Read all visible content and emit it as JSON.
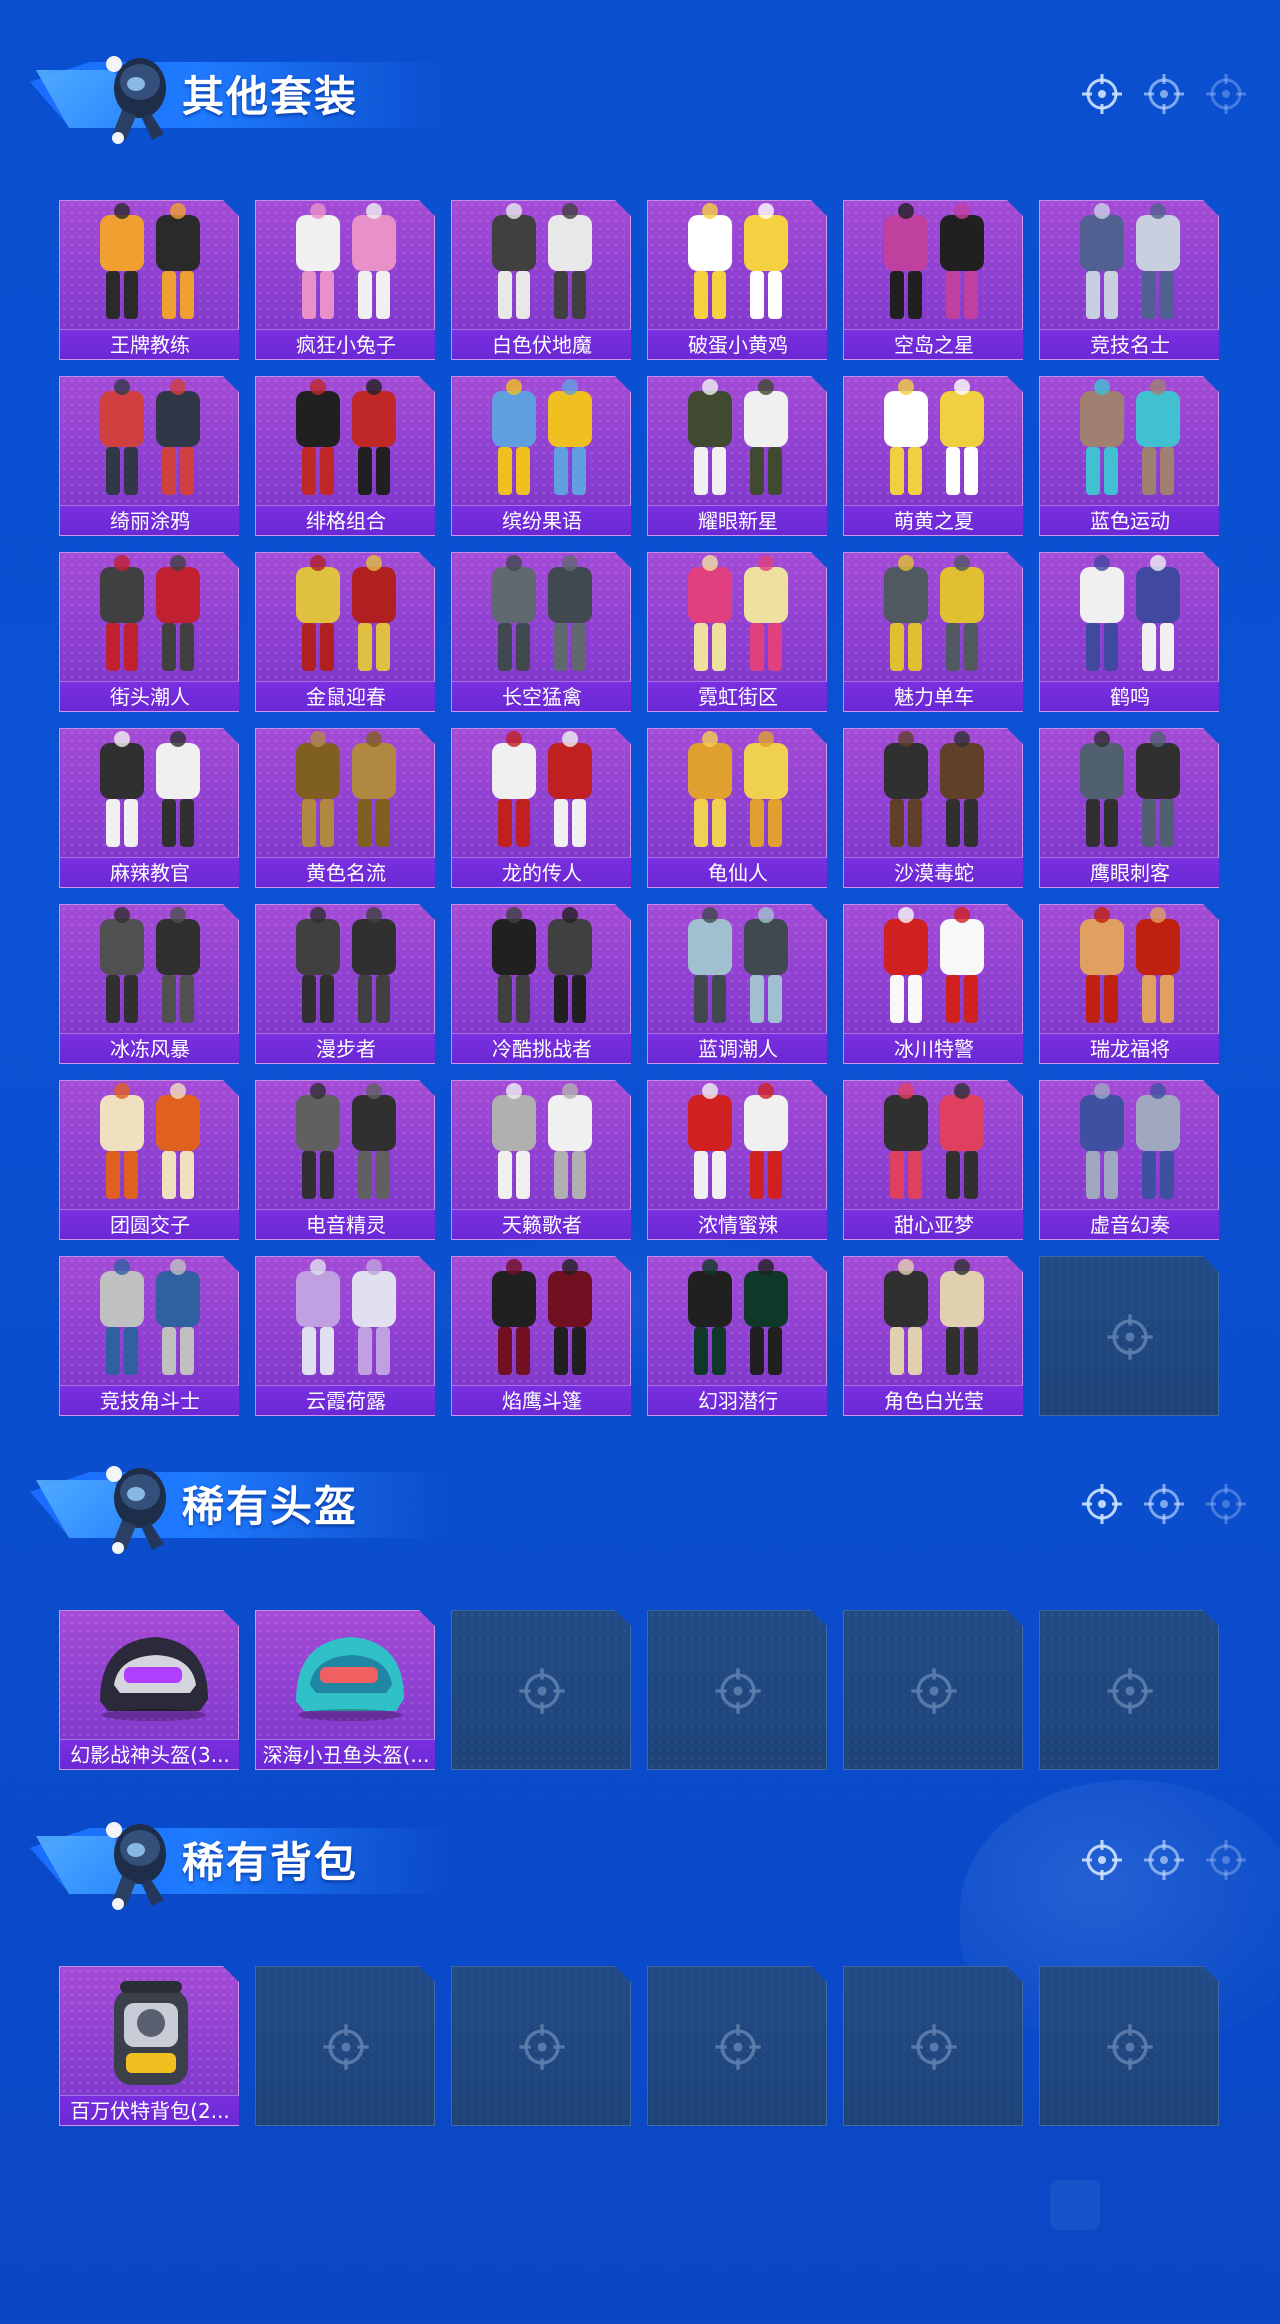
{
  "sections": [
    {
      "title": "其他套装",
      "items": [
        {
          "label": "王牌教练"
        },
        {
          "label": "疯狂小兔子"
        },
        {
          "label": "白色伏地魔"
        },
        {
          "label": "破蛋小黄鸡"
        },
        {
          "label": "空岛之星"
        },
        {
          "label": "竞技名士"
        },
        {
          "label": "绮丽涂鸦"
        },
        {
          "label": "绯格组合"
        },
        {
          "label": "缤纷果语"
        },
        {
          "label": "耀眼新星"
        },
        {
          "label": "萌黄之夏"
        },
        {
          "label": "蓝色运动"
        },
        {
          "label": "街头潮人"
        },
        {
          "label": "金鼠迎春"
        },
        {
          "label": "长空猛禽"
        },
        {
          "label": "霓虹街区"
        },
        {
          "label": "魅力单车"
        },
        {
          "label": "鹤鸣"
        },
        {
          "label": "麻辣教官"
        },
        {
          "label": "黄色名流"
        },
        {
          "label": "龙的传人"
        },
        {
          "label": "龟仙人"
        },
        {
          "label": "沙漠毒蛇"
        },
        {
          "label": "鹰眼刺客"
        },
        {
          "label": "冰冻风暴"
        },
        {
          "label": "漫步者"
        },
        {
          "label": "冷酷挑战者"
        },
        {
          "label": "蓝调潮人"
        },
        {
          "label": "冰川特警"
        },
        {
          "label": "瑞龙福将"
        },
        {
          "label": "团圆交子"
        },
        {
          "label": "电音精灵"
        },
        {
          "label": "天籁歌者"
        },
        {
          "label": "浓情蜜辣"
        },
        {
          "label": "甜心亚梦"
        },
        {
          "label": "虚音幻奏"
        },
        {
          "label": "竞技角斗士"
        },
        {
          "label": "云霞荷露"
        },
        {
          "label": "焰鹰斗篷"
        },
        {
          "label": "幻羽潜行"
        },
        {
          "label": "角色白光莹"
        }
      ],
      "empty_slots": 1
    },
    {
      "title": "稀有头盔",
      "items": [
        {
          "label": "幻影战神头盔(3..."
        },
        {
          "label": "深海小丑鱼头盔(..."
        }
      ],
      "empty_slots": 4
    },
    {
      "title": "稀有背包",
      "items": [
        {
          "label": "百万伏特背包(2..."
        }
      ],
      "empty_slots": 5
    }
  ],
  "colors": {
    "background": "#0b52d4",
    "card_purple": "#9a45d4",
    "label_bar": "#6b28d4",
    "empty_slot": "#214980",
    "title_text": "#ffffff"
  },
  "icons": {
    "mascot": "soldier-mascot-icon",
    "target": "crosshair-target-icon"
  }
}
